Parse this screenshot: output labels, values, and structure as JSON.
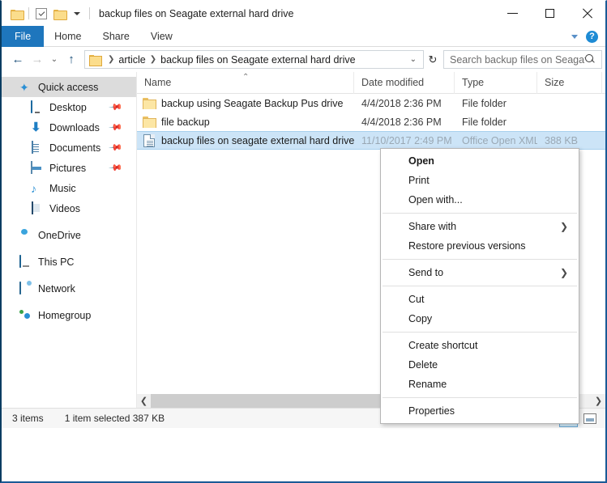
{
  "window": {
    "title": "backup files on Seagate external hard drive",
    "quick_access_toolbar": [
      {
        "name": "folder-icon",
        "label": ""
      },
      {
        "name": "properties-icon",
        "label": ""
      },
      {
        "name": "new-folder-icon",
        "label": ""
      },
      {
        "name": "customize-caret-icon",
        "label": ""
      }
    ],
    "controls": {
      "minimize": "–",
      "maximize": "□",
      "close": "✕"
    }
  },
  "ribbon": {
    "tabs": [
      {
        "label": "File",
        "active": true
      },
      {
        "label": "Home",
        "active": false
      },
      {
        "label": "Share",
        "active": false
      },
      {
        "label": "View",
        "active": false
      }
    ],
    "collapse_label": "⌄",
    "help_label": "?"
  },
  "address": {
    "back": "←",
    "forward": "→",
    "recent": "⌄",
    "up": "↑",
    "crumbs": [
      "article",
      "backup files on Seagate external hard drive"
    ],
    "separator": "❯",
    "dropdown": "⌄",
    "refresh": "↻"
  },
  "search": {
    "placeholder": "Search backup files on Seagat...",
    "icon": "search-icon"
  },
  "sidebar": {
    "items": [
      {
        "label": "Quick access",
        "icon": "star-pin-icon",
        "level": 0,
        "selected": true,
        "pinned": false
      },
      {
        "label": "Desktop",
        "icon": "desktop-icon",
        "level": 1,
        "selected": false,
        "pinned": true
      },
      {
        "label": "Downloads",
        "icon": "download-icon",
        "level": 1,
        "selected": false,
        "pinned": true
      },
      {
        "label": "Documents",
        "icon": "documents-icon",
        "level": 1,
        "selected": false,
        "pinned": true
      },
      {
        "label": "Pictures",
        "icon": "pictures-icon",
        "level": 1,
        "selected": false,
        "pinned": true
      },
      {
        "label": "Music",
        "icon": "music-icon",
        "level": 1,
        "selected": false,
        "pinned": false
      },
      {
        "label": "Videos",
        "icon": "video-icon",
        "level": 1,
        "selected": false,
        "pinned": false
      },
      {
        "label": "OneDrive",
        "icon": "cloud-icon",
        "level": 0,
        "selected": false,
        "pinned": false
      },
      {
        "label": "This PC",
        "icon": "computer-icon",
        "level": 0,
        "selected": false,
        "pinned": false
      },
      {
        "label": "Network",
        "icon": "network-icon",
        "level": 0,
        "selected": false,
        "pinned": false
      },
      {
        "label": "Homegroup",
        "icon": "homegroup-icon",
        "level": 0,
        "selected": false,
        "pinned": false
      }
    ],
    "pin_glyph": "📌"
  },
  "filelist": {
    "columns": [
      {
        "key": "name",
        "label": "Name"
      },
      {
        "key": "date",
        "label": "Date modified"
      },
      {
        "key": "type",
        "label": "Type"
      },
      {
        "key": "size",
        "label": "Size"
      }
    ],
    "sort_indicator": "⌃",
    "rows": [
      {
        "name": "backup using Seagate Backup Pus drive",
        "date": "4/4/2018 2:36 PM",
        "type": "File folder",
        "size": "",
        "icon": "folder-icon",
        "selected": false,
        "obscured": false
      },
      {
        "name": "file backup",
        "date": "4/4/2018 2:36 PM",
        "type": "File folder",
        "size": "",
        "icon": "folder-icon",
        "selected": false,
        "obscured": false
      },
      {
        "name": "backup files on seagate external hard drive",
        "date": "11/10/2017 2:49 PM",
        "type": "Office Open XML",
        "size": "388 KB",
        "icon": "document-icon",
        "selected": true,
        "obscured": true
      }
    ],
    "scrollbar": {
      "left_arrow": "❮",
      "right_arrow": "❯"
    }
  },
  "context_menu": {
    "groups": [
      [
        {
          "label": "Open",
          "bold": true,
          "submenu": false
        },
        {
          "label": "Print",
          "bold": false,
          "submenu": false
        },
        {
          "label": "Open with...",
          "bold": false,
          "submenu": false
        }
      ],
      [
        {
          "label": "Share with",
          "bold": false,
          "submenu": true
        },
        {
          "label": "Restore previous versions",
          "bold": false,
          "submenu": false
        }
      ],
      [
        {
          "label": "Send to",
          "bold": false,
          "submenu": true
        }
      ],
      [
        {
          "label": "Cut",
          "bold": false,
          "submenu": false
        },
        {
          "label": "Copy",
          "bold": false,
          "submenu": false
        }
      ],
      [
        {
          "label": "Create shortcut",
          "bold": false,
          "submenu": false
        },
        {
          "label": "Delete",
          "bold": false,
          "submenu": false
        },
        {
          "label": "Rename",
          "bold": false,
          "submenu": false
        }
      ],
      [
        {
          "label": "Properties",
          "bold": false,
          "submenu": false
        }
      ]
    ],
    "submenu_arrow": "❯"
  },
  "statusbar": {
    "item_count": "3 items",
    "selection": "1 item selected  387 KB",
    "views": [
      {
        "name": "details-view-button",
        "active": true
      },
      {
        "name": "large-icons-view-button",
        "active": false
      }
    ]
  },
  "colors": {
    "accent": "#1e76bd",
    "selection": "#cce4f7",
    "selection_border": "#a8d0ee",
    "folder_yellow": "#fce6a4",
    "nav_selected": "#dcdcdc",
    "window_frame": "#1a5a96"
  }
}
